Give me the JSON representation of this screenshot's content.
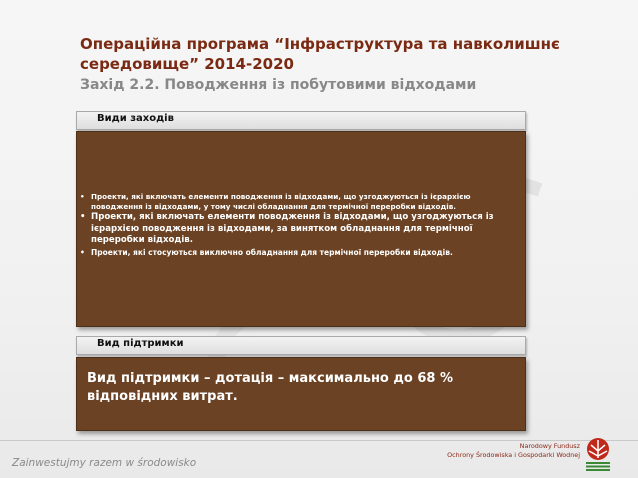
{
  "title": "Операційна програма “Інфраструктура та навколишнє середовище” 2014-2020",
  "subtitle": "Захід 2.2. Поводження із побутовими відходами",
  "section_measures": {
    "label": "Види заходів",
    "items": [
      "Проекти, які включать елементи поводження із відходами, що узгоджуються із ієрархією поводження із відходами, у тому числі обладнання для термічної переробки відходів.",
      "Проекти, які включать елементи поводження із відходами, що узгоджуються із ієрархією поводження із відходами, за винятком обладнання для термічної переробки відходів.",
      "Проекти, які стосуються виключно обладнання для термічної переробки відходів."
    ]
  },
  "section_support": {
    "label": "Вид підтримки",
    "text": "Вид підтримки – дотація – максимально до 68 % відповідних витрат."
  },
  "footer": {
    "slogan": "Zainwestujmy razem w środowisko",
    "fund_line1": "Narodowy Fundusz",
    "fund_line2": "Ochrony Środowiska i Gospodarki Wodnej",
    "logo_icon": "nfosigw-logo-icon"
  },
  "colors": {
    "title": "#7a2a12",
    "subtitle": "#888888",
    "box_fill": "#6b4223",
    "logo_red": "#c0281a",
    "logo_green": "#3a8a35"
  }
}
